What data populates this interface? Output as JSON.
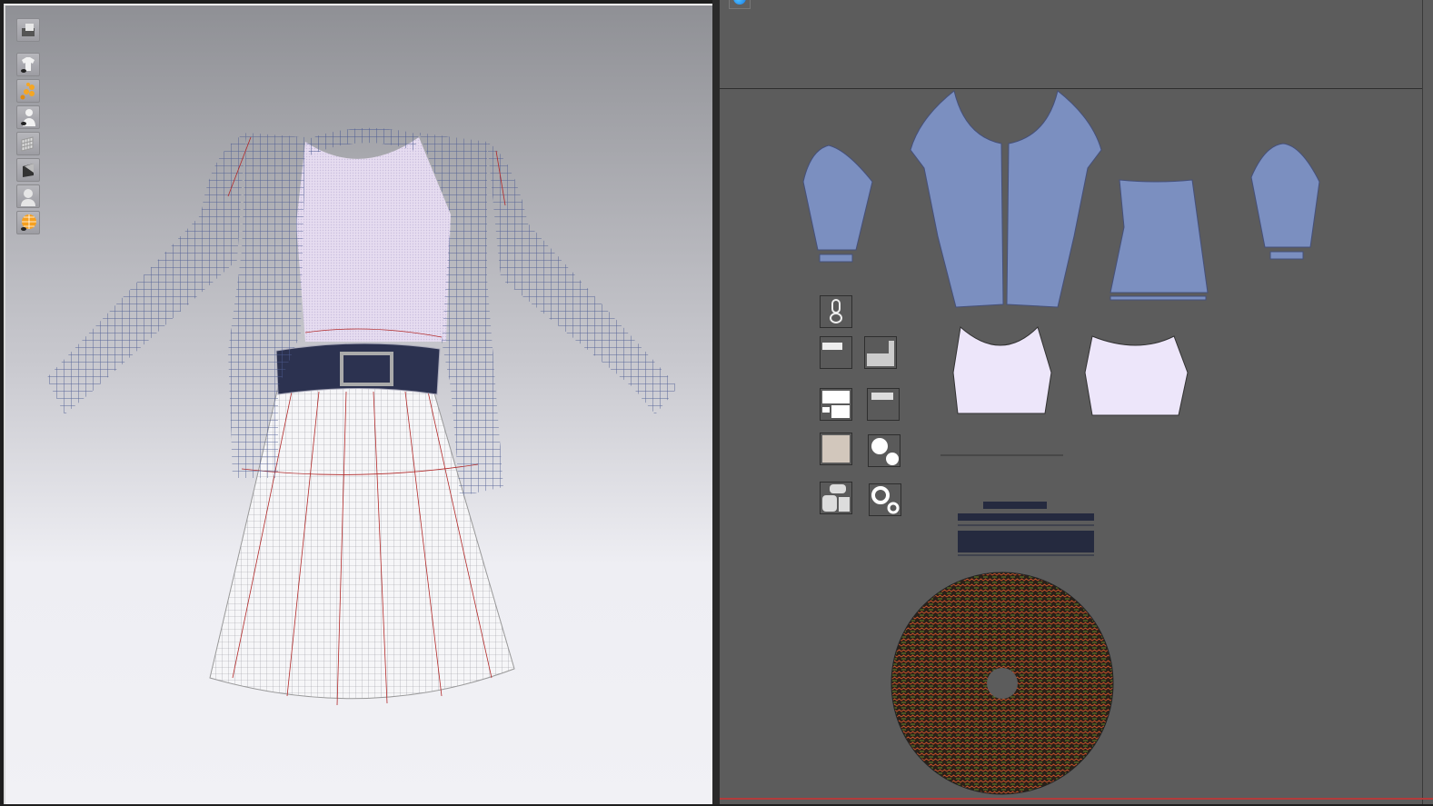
{
  "app": {
    "viewport_3d": {
      "toolbar": [
        {
          "icon": "avatar-display-icon"
        },
        {
          "icon": "show-garment-icon"
        },
        {
          "icon": "show-pins-icon"
        },
        {
          "icon": "show-avatar-icon"
        },
        {
          "icon": "texture-mode-icon"
        },
        {
          "icon": "shaded-mode-icon"
        },
        {
          "icon": "avatar-silhouette-icon"
        },
        {
          "icon": "show-3d-grid-icon"
        }
      ]
    },
    "pattern_window": {
      "top_button": {
        "icon": "sphere-icon"
      },
      "library_thumbnails": [
        {
          "icon": "zipper-puller-icon"
        },
        {
          "icon": "label-icon"
        },
        {
          "icon": "trim-grid-icon"
        },
        {
          "icon": "fabric-swatch-icon"
        },
        {
          "icon": "ruffle-trim-icon"
        },
        {
          "icon": "beige-swatch-icon"
        },
        {
          "icon": "buttons-icon"
        },
        {
          "icon": "hardware-icon"
        },
        {
          "icon": "rings-icon"
        }
      ]
    }
  },
  "colors": {
    "jacket": "#7b8fc0",
    "tank": "#ede6fa",
    "panel_bg": "#5c5c5c",
    "belt": "#252a3f",
    "seam_red": "#b22a2a"
  }
}
